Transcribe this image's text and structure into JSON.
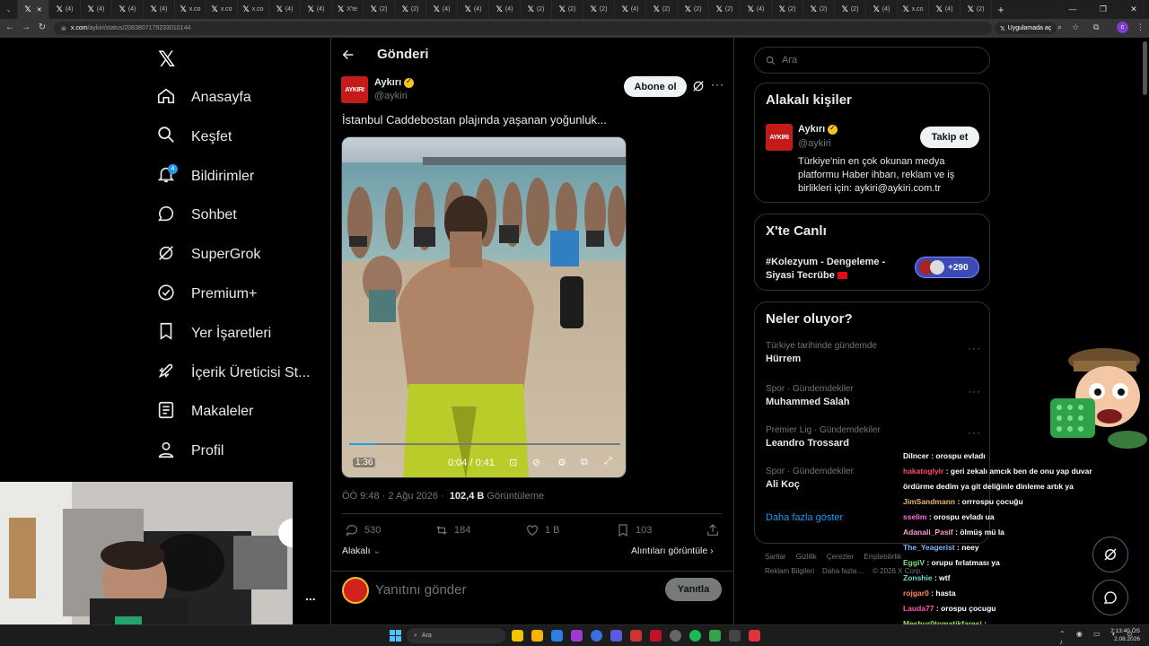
{
  "browser": {
    "tabs": [
      {
        "label": "",
        "active": false
      },
      {
        "label": "",
        "active": true
      },
      {
        "label": "(4)",
        "active": false
      },
      {
        "label": "(4)",
        "active": false
      },
      {
        "label": "(4)",
        "active": false
      },
      {
        "label": "(4)",
        "active": false
      },
      {
        "label": "x.co",
        "active": false
      },
      {
        "label": "x.co",
        "active": false
      },
      {
        "label": "x.co",
        "active": false
      },
      {
        "label": "(4)",
        "active": false
      },
      {
        "label": "(4)",
        "active": false
      },
      {
        "label": "X'te",
        "active": false
      },
      {
        "label": "(2)",
        "active": false
      },
      {
        "label": "(2)",
        "active": false
      },
      {
        "label": "(4)",
        "active": false
      },
      {
        "label": "(4)",
        "active": false
      },
      {
        "label": "(4)",
        "active": false
      },
      {
        "label": "(2)",
        "active": false
      },
      {
        "label": "(2)",
        "active": false
      },
      {
        "label": "(2)",
        "active": false
      },
      {
        "label": "(4)",
        "active": false
      },
      {
        "label": "(2)",
        "active": false
      },
      {
        "label": "(2)",
        "active": false
      },
      {
        "label": "(2)",
        "active": false
      },
      {
        "label": "(4)",
        "active": false
      },
      {
        "label": "(2)",
        "active": false
      },
      {
        "label": "(2)",
        "active": false
      },
      {
        "label": "(2)",
        "active": false
      },
      {
        "label": "(4)",
        "active": false
      },
      {
        "label": "x.co",
        "active": false
      },
      {
        "label": "(4)",
        "active": false
      },
      {
        "label": "(2)",
        "active": false
      }
    ],
    "url_host": "x.com",
    "url_path": "/aykiri/status/2083807179233010144",
    "app_open_label": "Uygulamada aç"
  },
  "nav": {
    "items": [
      {
        "label": "Anasayfa",
        "icon": "home-icon"
      },
      {
        "label": "Keşfet",
        "icon": "search-icon"
      },
      {
        "label": "Bildirimler",
        "icon": "bell-icon",
        "badge": "4"
      },
      {
        "label": "Sohbet",
        "icon": "chat-icon"
      },
      {
        "label": "SuperGrok",
        "icon": "grok-icon"
      },
      {
        "label": "Premium+",
        "icon": "premium-icon"
      },
      {
        "label": "Yer İşaretleri",
        "icon": "bookmark-icon"
      },
      {
        "label": "İçerik Üreticisi St...",
        "icon": "rocket-icon"
      },
      {
        "label": "Makaleler",
        "icon": "article-icon"
      },
      {
        "label": "Profil",
        "icon": "profile-icon"
      }
    ],
    "more": "..."
  },
  "post": {
    "header_title": "Gönderi",
    "author_name": "Aykırı",
    "author_handle": "@aykiri",
    "avatar_text": "AYKIRI",
    "subscribe_label": "Abone ol",
    "text": "İstanbul Caddebostan plajında yaşanan yoğunluk...",
    "video": {
      "duration_badge": "1:36",
      "time": "0:04 / 0:41",
      "progress": 0.1
    },
    "time": "ÖÖ 9:48 · 2 Ağu 2026 ·",
    "views_count": "102,4 B",
    "views_label": "Görüntüleme",
    "actions": {
      "replies": "530",
      "reposts": "184",
      "likes": "1 B",
      "bookmarks": "103"
    },
    "related_label": "Alakalı",
    "quotes_label": "Alıntıları görüntüle",
    "reply_placeholder": "Yanıtını gönder",
    "reply_button": "Yanıtla"
  },
  "right": {
    "search_placeholder": "Ara",
    "related_people": {
      "title": "Alakalı kişiler",
      "name": "Aykırı",
      "handle": "@aykiri",
      "follow_label": "Takip et",
      "bio_lines": [
        "Türkiye'nin en çok okunan medya",
        "platformu Haber ihbarı, reklam ve iş",
        "birlikleri için: aykiri@aykiri.com.tr"
      ]
    },
    "live": {
      "title": "X'te Canlı",
      "line1": "#Kolezyum - Dengeleme -",
      "line2": "Siyasi Tecrübe",
      "count": "+290"
    },
    "trends": {
      "title": "Neler oluyor?",
      "items": [
        {
          "context": "Türkiye tarihinde gündemde",
          "name": "Hürrem"
        },
        {
          "context": "Spor · Gündemdekiler",
          "name": "Muhammed Salah"
        },
        {
          "context": "Premier Lig · Gündemdekiler",
          "name": "Leandro Trossard"
        },
        {
          "context": "Spor · Gündemdekiler",
          "name": "Ali Koç"
        }
      ],
      "show_more": "Daha fazla göster"
    },
    "footer": [
      "Şartlar",
      "Gizlilik",
      "Çerezler",
      "Erişilebilirlik",
      "Reklam Bilgileri",
      "Daha fazla ...",
      "© 2026 X Corp."
    ]
  },
  "chat": [
    {
      "user": "Dilncer",
      "msg": "orospu evladı",
      "color": "#ffffff"
    },
    {
      "user": "hakatoglylr",
      "msg": "geri zekalı amcık ben de onu yap duvar",
      "color": "#ff4a6a"
    },
    {
      "user": "",
      "msg": "ördürme dedim ya git deliğinle dinleme artık ya",
      "color": "#ffffff"
    },
    {
      "user": "JimSandmann",
      "msg": "orrrospu çocuğu",
      "color": "#e8b86a"
    },
    {
      "user": "sselim",
      "msg": "orospu evladı ua",
      "color": "#ff6fe0"
    },
    {
      "user": "Adanali_Pasif",
      "msg": "ölmüş mü la",
      "color": "#ff9ad5"
    },
    {
      "user": "The_Yeagerist",
      "msg": "neey",
      "color": "#7ab8ff"
    },
    {
      "user": "EggiV",
      "msg": "orupu fırlatması ya",
      "color": "#7be07b"
    },
    {
      "user": "Zonshie",
      "msg": "wtf",
      "color": "#5fe0c0"
    },
    {
      "user": "rojgar0",
      "msg": "hasta",
      "color": "#ff8c5a"
    },
    {
      "user": "Lauda77",
      "msg": "orospu çocugu",
      "color": "#ff5ab4"
    },
    {
      "user": "Meshur0tomatikfaresi",
      "msg": "",
      "color": "#9de05a"
    }
  ],
  "taskbar": {
    "search_placeholder": "Ara",
    "time": "2:13:40 ÖS",
    "date": "2.08.2026"
  }
}
